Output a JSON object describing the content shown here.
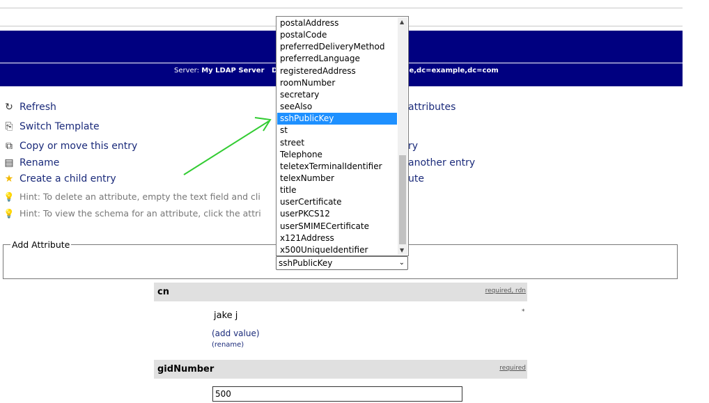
{
  "server": {
    "label": "Server:",
    "name": "My LDAP Server",
    "dn_prefix": "D",
    "dn_tail": "ople,dc=example,dc=com"
  },
  "menu": {
    "refresh": "Refresh",
    "switch_template": "Switch Template",
    "copy_move": "Copy or move this entry",
    "rename": "Rename",
    "create_child": "Create a child entry",
    "hint_delete": "Hint: To delete an attribute, empty the text field and cli",
    "hint_schema": "Hint: To view the schema for an attribute, click the attri",
    "right_attributes": "attributes",
    "right_entry": "ry",
    "right_another_entry": "another entry",
    "right_ute": "ute"
  },
  "add_attribute": {
    "legend": "Add Attribute",
    "selected": "sshPublicKey",
    "options": [
      "postalAddress",
      "postalCode",
      "preferredDeliveryMethod",
      "preferredLanguage",
      "registeredAddress",
      "roomNumber",
      "secretary",
      "seeAlso",
      "sshPublicKey",
      "st",
      "street",
      "Telephone",
      "teletexTerminalIdentifier",
      "telexNumber",
      "title",
      "userCertificate",
      "userPKCS12",
      "userSMIMECertificate",
      "x121Address",
      "x500UniqueIdentifier"
    ]
  },
  "attributes": {
    "cn": {
      "name": "cn",
      "flags": "required, rdn",
      "value": "jake j",
      "add_value": "(add value)",
      "rename": "(rename)",
      "mark": "*"
    },
    "gid": {
      "name": "gidNumber",
      "flags": "required",
      "value": "500"
    }
  },
  "icons": {
    "refresh": "refresh-icon",
    "switch_template": "switch-template-icon",
    "copy": "copy-icon",
    "rename": "rename-icon",
    "create_child": "star-icon",
    "hint": "light-bulb-icon"
  },
  "colors": {
    "header_bg": "#000080",
    "link": "#1a2a7a",
    "selection": "#1e90ff",
    "arrow": "#33cc33"
  }
}
